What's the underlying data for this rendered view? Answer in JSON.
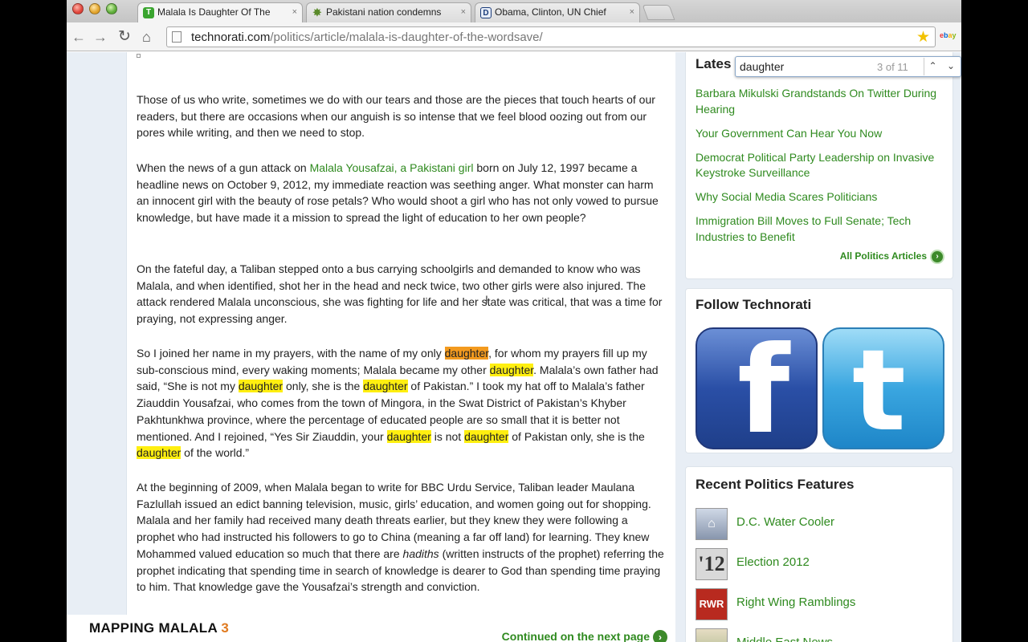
{
  "browser": {
    "tabs": [
      {
        "label": "Malala Is Daughter Of The",
        "favicon": "T"
      },
      {
        "label": "Pakistani nation condemns",
        "favicon": "✸"
      },
      {
        "label": "Obama, Clinton, UN Chief",
        "favicon": "D"
      }
    ],
    "tab_close": "×",
    "url_host": "technorati.com",
    "url_path": "/politics/article/malala-is-daughter-of-the-wordsave/",
    "nav": {
      "back": "←",
      "forward": "→",
      "reload": "↻",
      "home": "⌂",
      "star": "★",
      "ebay": "ebay"
    }
  },
  "find_bar": {
    "query": "daughter",
    "count": "3 of 11",
    "prev": "⌃",
    "next": "⌄"
  },
  "article": {
    "para1": "Those of us who write, sometimes we do with our tears and those are the pieces that touch hearts of our readers, but there are occasions when our anguish is so intense that we feel blood oozing out from our pores while writing, and then we need to stop.",
    "para2_a": "When the news of a gun attack on ",
    "para2_link": "Malala Yousafzai, a Pakistani girl",
    "para2_b": " born on July 12, 1997 became a headline news on October 9, 2012, my immediate reaction was seething anger. What monster can harm an innocent girl with the beauty of rose petals? Who would shoot a girl who has not only vowed to pursue knowledge, but have made it a mission to spread the light of education to her own people?",
    "para3": "On the fateful day, a Taliban stepped onto a bus carrying schoolgirls and demanded to know who was Malala, and when identified, shot her in the head and neck twice, two other girls were also injured. The attack rendered Malala unconscious, she was fighting for life and her state was critical, that was a time for praying, not expressing anger.",
    "para4": {
      "t1": "So I joined her name in my prayers, with the name of my only ",
      "h1": "daughter",
      "t2": ", for whom my prayers fill up my sub-conscious mind, every waking moments; Malala became my other ",
      "h2": "daughter",
      "t3": ". Malala’s own father had said, “She is not my ",
      "h3": "daughter",
      "t4": " only, she is the ",
      "h4": "daughter",
      "t5": " of Pakistan.” I took my hat off to Malala’s father Ziauddin Yousafzai, who comes from the town of Mingora, in the Swat District of Pakistan’s Khyber Pakhtunkhwa province, where the percentage of educated people are so small that it is better not mentioned. And I rejoined, “Yes Sir Ziauddin, your ",
      "h5": "daughter",
      "t6": " is not ",
      "h6": "daughter",
      "t7": " of Pakistan only, she is the ",
      "h7": "daughter",
      "t8": " of the world.”"
    },
    "para5_a": "At the beginning of 2009, when Malala began to write for BBC Urdu Service, Taliban leader Maulana Fazlullah issued an edict banning television, music, girls’ education, and women going out for shopping. Malala and her family had received many death threats earlier, but they knew they were following a prophet who had instructed his followers to go to China (meaning a far off land) for learning. They knew Mohammed valued education so much that there are ",
    "para5_em": "hadiths",
    "para5_b": " (written instructs of the prophet) referring the prophet indicating that spending time in search of knowledge is dearer to God than spending time praying to him. That knowledge gave the Yousafzai’s strength and conviction.",
    "continued": "Continued on the next page",
    "continued_icon": "›"
  },
  "sidebar": {
    "latest_title": "Lates",
    "latest_items": [
      "Barbara Mikulski Grandstands On Twitter During Hearing",
      "Your Government Can Hear You Now",
      "Democrat Political Party Leadership on Invasive Keystroke Surveillance",
      "Why Social Media Scares Politicians",
      "Immigration Bill Moves to Full Senate; Tech Industries to Benefit"
    ],
    "all_politics": "All Politics Articles",
    "all_politics_icon": "›",
    "follow_title": "Follow Technorati",
    "facebook_glyph": "f",
    "twitter_glyph": "t",
    "recent_title": "Recent Politics Features",
    "recent_items": [
      {
        "label": "D.C. Water Cooler",
        "thumb": "⌂"
      },
      {
        "label": "Election 2012",
        "thumb": "'12"
      },
      {
        "label": "Right Wing Ramblings",
        "thumb": "RWR"
      },
      {
        "label": "Middle East News",
        "thumb": ""
      }
    ]
  },
  "caption": {
    "text": "MAPPING MALALA ",
    "num": "3"
  },
  "cursor": "I"
}
